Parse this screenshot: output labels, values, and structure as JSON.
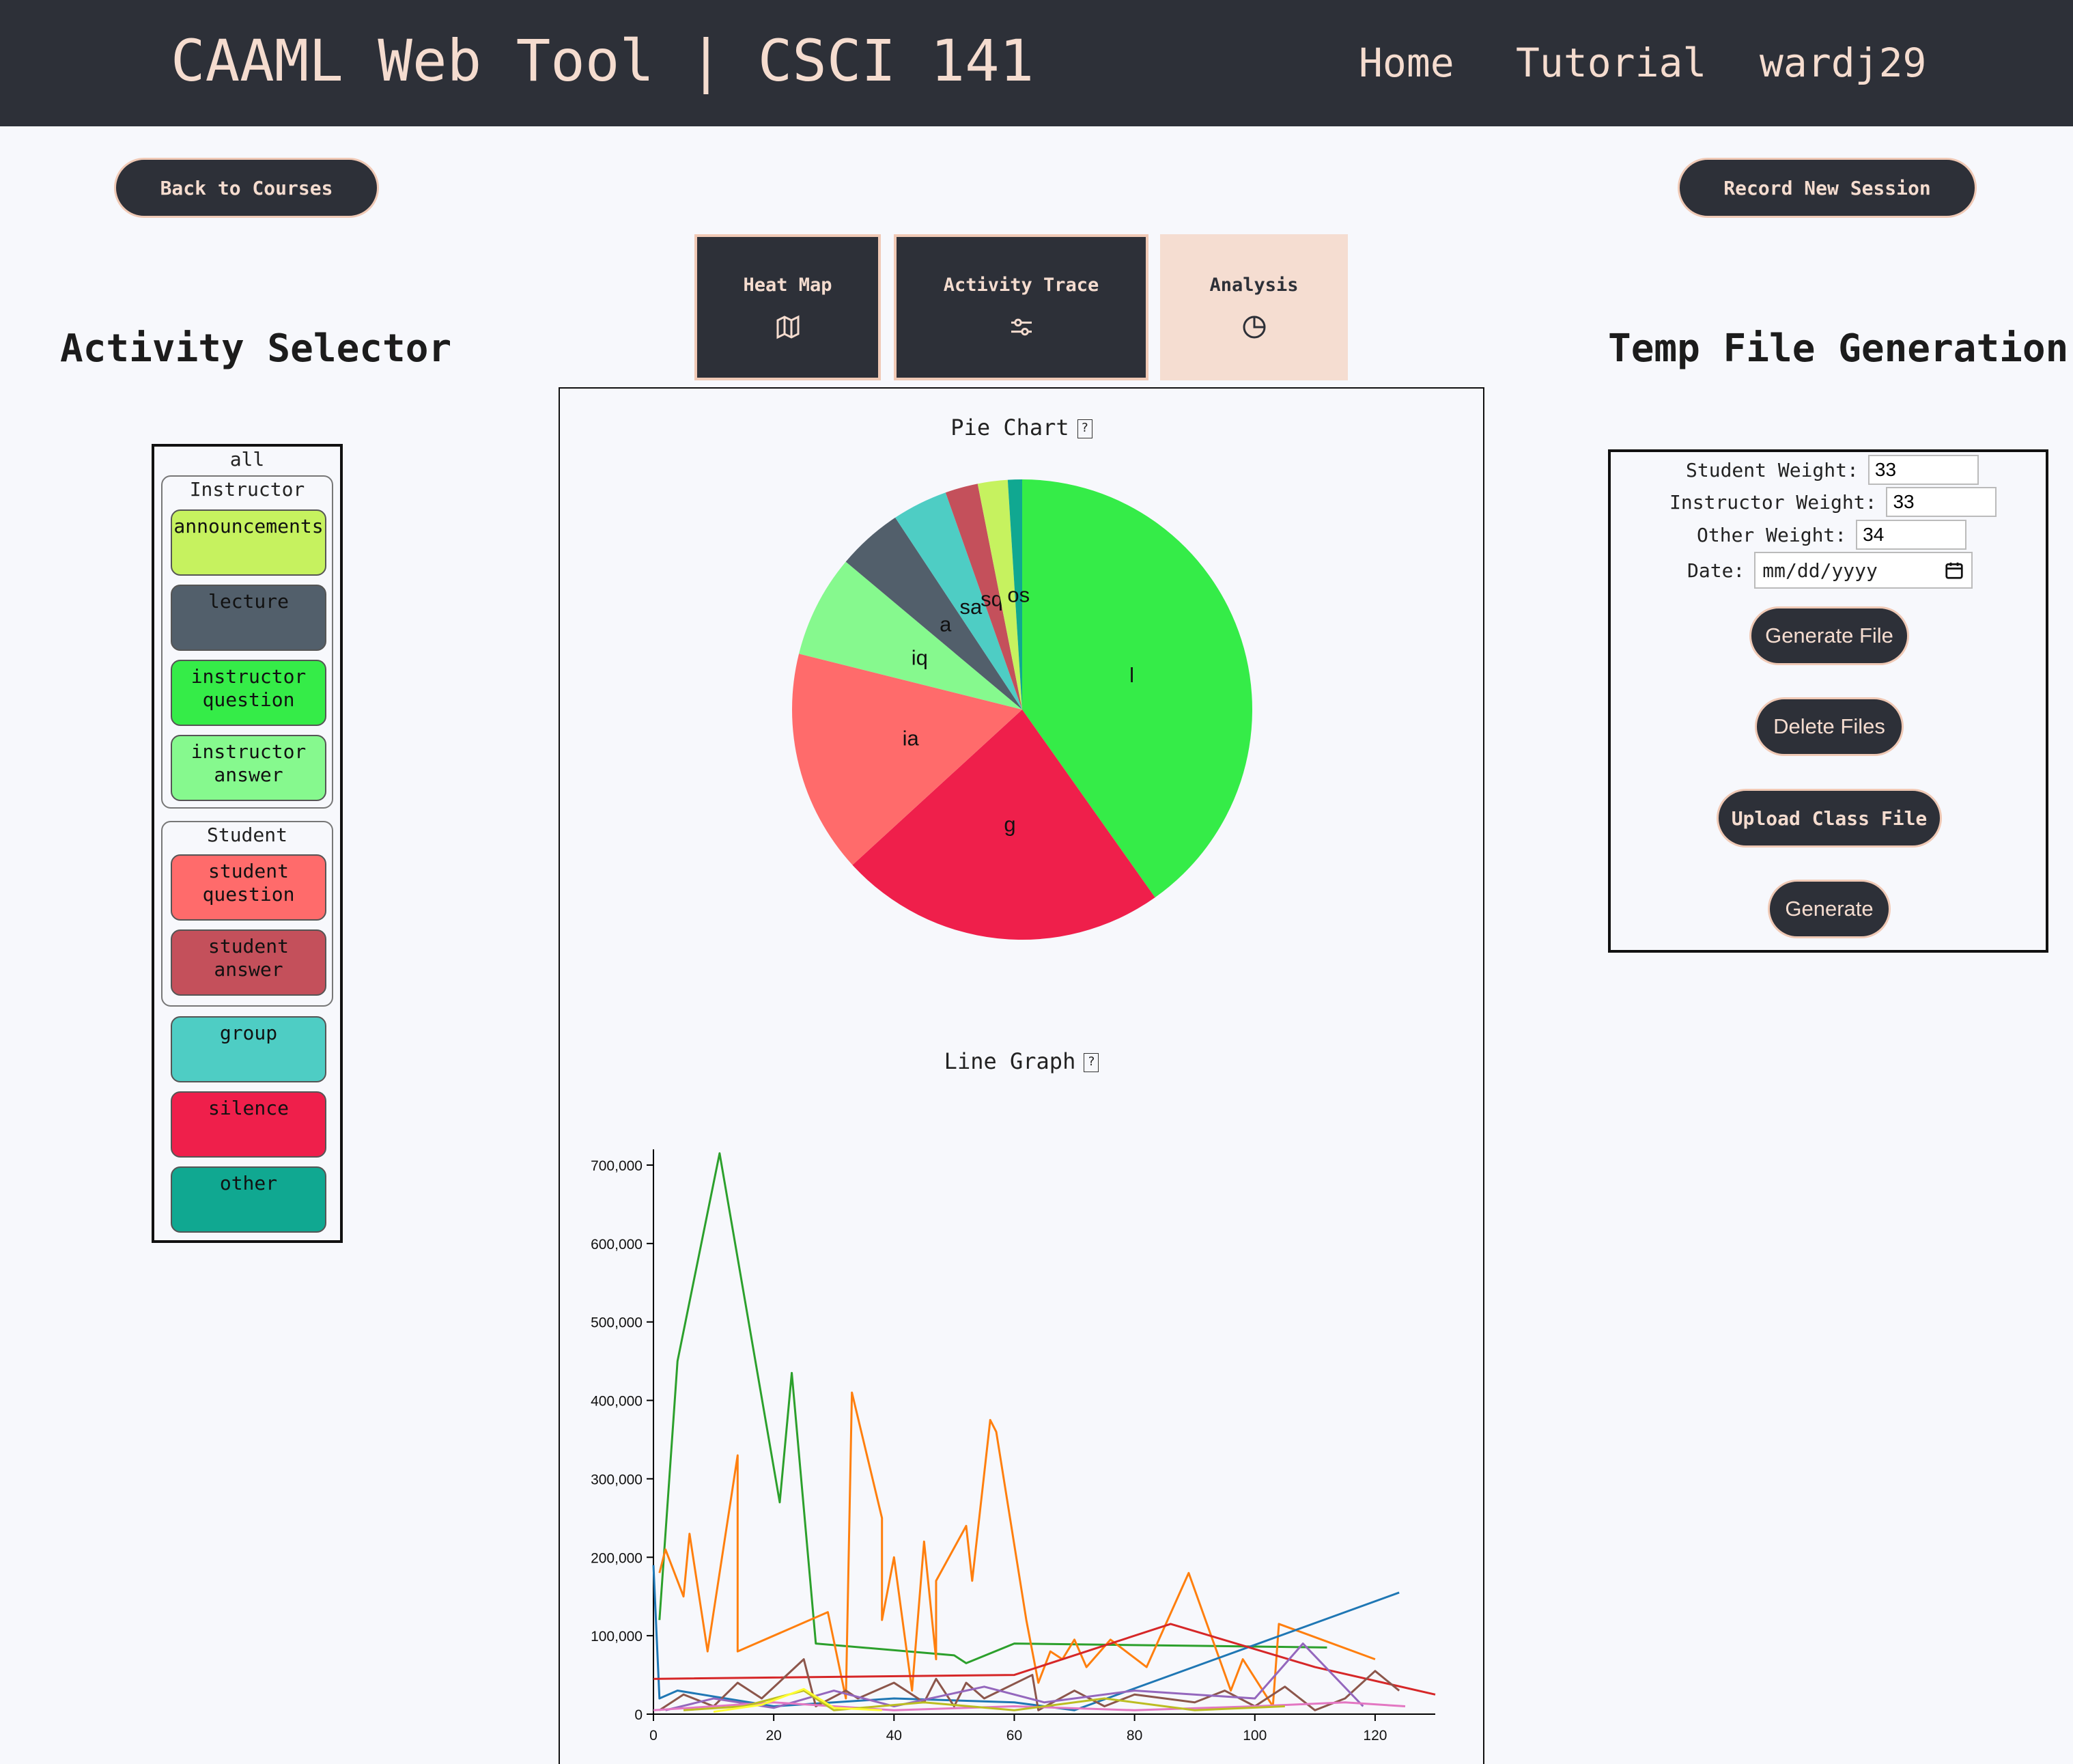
{
  "header": {
    "brand": "CAAML Web Tool | CSCI 141",
    "nav": [
      "Home",
      "Tutorial",
      "wardj29"
    ]
  },
  "actions": {
    "back": "Back to Courses",
    "record": "Record New Session"
  },
  "tabs": [
    {
      "label": "Heat Map",
      "icon": "map-icon"
    },
    {
      "label": "Activity Trace",
      "icon": "sliders-icon"
    },
    {
      "label": "Analysis",
      "icon": "pie-icon",
      "active": true
    }
  ],
  "selector": {
    "title": "Activity Selector",
    "all": "all",
    "groups": [
      "Instructor",
      "Student"
    ],
    "activities": [
      {
        "label": "announcements",
        "color": "#c6f25f"
      },
      {
        "label": "lecture",
        "color": "#525f6b"
      },
      {
        "label": "instructor question",
        "color": "#35ec48"
      },
      {
        "label": "instructor answer",
        "color": "#86f98e"
      },
      {
        "label": "student question",
        "color": "#ff6b6b"
      },
      {
        "label": "student answer",
        "color": "#c4505b"
      },
      {
        "label": "group",
        "color": "#4ecdc4"
      },
      {
        "label": "silence",
        "color": "#ef1f4b"
      },
      {
        "label": "other",
        "color": "#10a891"
      }
    ]
  },
  "analysis": {
    "pie_title": "Pie Chart",
    "line_title": "Line Graph",
    "help": "?"
  },
  "chart_data": [
    {
      "type": "pie",
      "title": "Pie Chart",
      "slices": [
        {
          "label": "l",
          "value": 40.2,
          "color": "#35ec48"
        },
        {
          "label": "g",
          "value": 23.0,
          "color": "#ef1f4b"
        },
        {
          "label": "ia",
          "value": 15.7,
          "color": "#ff6b6b"
        },
        {
          "label": "iq",
          "value": 7.2,
          "color": "#86f98e"
        },
        {
          "label": "a",
          "value": 4.6,
          "color": "#525f6b"
        },
        {
          "label": "sa",
          "value": 3.9,
          "color": "#4ecdc4"
        },
        {
          "label": "sq",
          "value": 2.3,
          "color": "#c4505b"
        },
        {
          "label": "",
          "value": 2.1,
          "color": "#c6f25f"
        },
        {
          "label": "os",
          "value": 1.0,
          "color": "#10a891"
        }
      ]
    },
    {
      "type": "line",
      "title": "Line Graph",
      "xlim": [
        0,
        130
      ],
      "ylim": [
        0,
        720000
      ],
      "xticks": [
        0,
        20,
        40,
        60,
        80,
        100,
        120
      ],
      "yticks": [
        0,
        100000,
        200000,
        300000,
        400000,
        500000,
        600000,
        700000
      ],
      "ytick_labels": [
        "0",
        "100,000",
        "200,000",
        "300,000",
        "400,000",
        "500,000",
        "600,000",
        "700,000"
      ],
      "series": [
        {
          "color": "#2ca02c",
          "points": [
            [
              1,
              120000
            ],
            [
              4,
              450000
            ],
            [
              11,
              715000
            ],
            [
              21,
              270000
            ],
            [
              23,
              435000
            ],
            [
              27,
              90000
            ],
            [
              50,
              75000
            ],
            [
              52,
              65000
            ],
            [
              60,
              90000
            ],
            [
              112,
              85000
            ]
          ]
        },
        {
          "color": "#ff7f0e",
          "points": [
            [
              1,
              180000
            ],
            [
              2,
              210000
            ],
            [
              5,
              150000
            ],
            [
              6,
              230000
            ],
            [
              9,
              80000
            ],
            [
              14,
              330000
            ],
            [
              14,
              80000
            ],
            [
              29,
              130000
            ],
            [
              32,
              20000
            ],
            [
              33,
              410000
            ],
            [
              38,
              250000
            ],
            [
              38,
              120000
            ],
            [
              40,
              200000
            ],
            [
              43,
              30000
            ],
            [
              45,
              220000
            ],
            [
              47,
              70000
            ],
            [
              47,
              170000
            ],
            [
              52,
              240000
            ],
            [
              53,
              170000
            ],
            [
              56,
              375000
            ],
            [
              57,
              360000
            ],
            [
              62,
              120000
            ],
            [
              64,
              40000
            ],
            [
              66,
              80000
            ],
            [
              68,
              70000
            ],
            [
              70,
              95000
            ],
            [
              72,
              60000
            ],
            [
              76,
              95000
            ],
            [
              82,
              60000
            ],
            [
              89,
              180000
            ],
            [
              96,
              30000
            ],
            [
              98,
              70000
            ],
            [
              103,
              10000
            ],
            [
              104,
              115000
            ],
            [
              120,
              70000
            ]
          ]
        },
        {
          "color": "#1f77b4",
          "points": [
            [
              0,
              190000
            ],
            [
              1,
              20000
            ],
            [
              4,
              30000
            ],
            [
              20,
              10000
            ],
            [
              40,
              20000
            ],
            [
              60,
              15000
            ],
            [
              70,
              5000
            ],
            [
              124,
              155000
            ]
          ]
        },
        {
          "color": "#d62728",
          "points": [
            [
              0,
              45000
            ],
            [
              60,
              50000
            ],
            [
              86,
              115000
            ],
            [
              110,
              60000
            ],
            [
              130,
              25000
            ]
          ]
        },
        {
          "color": "#8c564b",
          "points": [
            [
              1,
              5000
            ],
            [
              5,
              25000
            ],
            [
              10,
              10000
            ],
            [
              14,
              40000
            ],
            [
              18,
              20000
            ],
            [
              25,
              70000
            ],
            [
              27,
              10000
            ],
            [
              32,
              30000
            ],
            [
              34,
              20000
            ],
            [
              40,
              40000
            ],
            [
              45,
              15000
            ],
            [
              47,
              45000
            ],
            [
              50,
              10000
            ],
            [
              52,
              40000
            ],
            [
              55,
              20000
            ],
            [
              63,
              50000
            ],
            [
              64,
              5000
            ],
            [
              70,
              30000
            ],
            [
              75,
              10000
            ],
            [
              80,
              25000
            ],
            [
              90,
              15000
            ],
            [
              95,
              30000
            ],
            [
              100,
              10000
            ],
            [
              105,
              35000
            ],
            [
              110,
              5000
            ],
            [
              115,
              20000
            ],
            [
              120,
              55000
            ],
            [
              124,
              30000
            ]
          ]
        },
        {
          "color": "#9467bd",
          "points": [
            [
              2,
              5000
            ],
            [
              10,
              20000
            ],
            [
              20,
              8000
            ],
            [
              30,
              30000
            ],
            [
              40,
              10000
            ],
            [
              55,
              35000
            ],
            [
              65,
              15000
            ],
            [
              80,
              30000
            ],
            [
              100,
              20000
            ],
            [
              108,
              90000
            ],
            [
              118,
              10000
            ]
          ]
        },
        {
          "color": "#e377c2",
          "points": [
            [
              0,
              5000
            ],
            [
              20,
              15000
            ],
            [
              40,
              5000
            ],
            [
              60,
              10000
            ],
            [
              80,
              5000
            ],
            [
              100,
              10000
            ],
            [
              115,
              15000
            ],
            [
              125,
              10000
            ]
          ]
        },
        {
          "color": "#bcbd22",
          "points": [
            [
              5,
              5000
            ],
            [
              15,
              10000
            ],
            [
              25,
              30000
            ],
            [
              30,
              5000
            ],
            [
              45,
              15000
            ],
            [
              60,
              5000
            ],
            [
              75,
              20000
            ],
            [
              90,
              5000
            ],
            [
              105,
              10000
            ]
          ]
        },
        {
          "color": "#ffff33",
          "points": [
            [
              10,
              3000
            ],
            [
              18,
              12000
            ],
            [
              25,
              32000
            ],
            [
              30,
              8000
            ],
            [
              38,
              5000
            ]
          ]
        }
      ]
    }
  ],
  "temp": {
    "title": "Temp File Generation",
    "student_label": "Student Weight:",
    "student_value": "33",
    "instructor_label": "Instructor Weight:",
    "instructor_value": "33",
    "other_label": "Other Weight:",
    "other_value": "34",
    "date_label": "Date:",
    "date_placeholder": "mm/dd/yyyy",
    "generate_file": "Generate File",
    "delete_files": "Delete Files",
    "upload": "Upload Class File",
    "generate": "Generate"
  }
}
